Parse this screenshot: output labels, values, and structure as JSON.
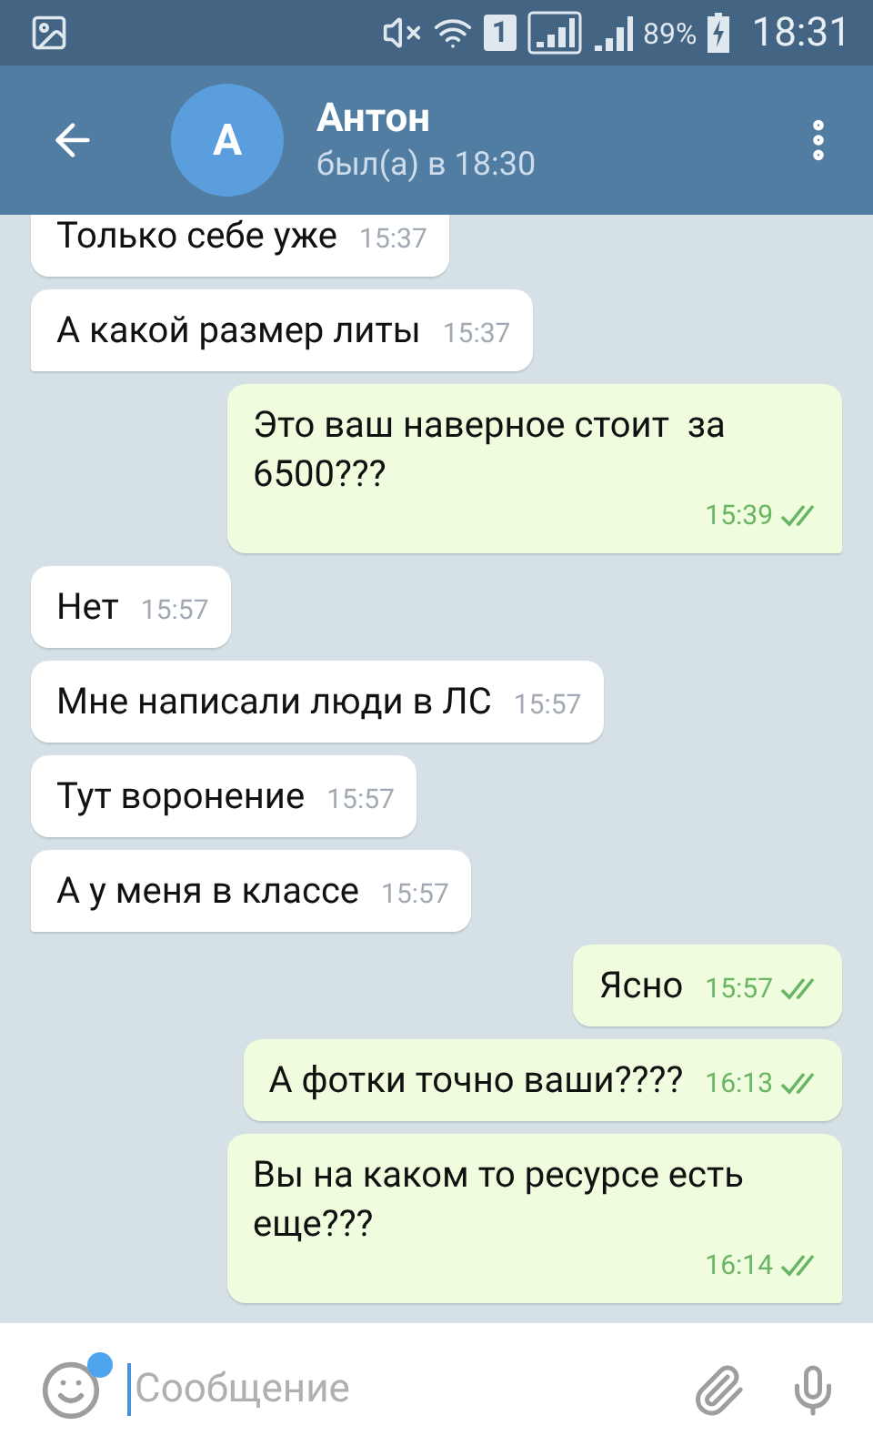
{
  "status_bar": {
    "sim_label": "1",
    "battery": "89%",
    "time": "18:31"
  },
  "header": {
    "avatar_letter": "А",
    "name": "Антон",
    "status": "был(а) в 18:30"
  },
  "messages": [
    {
      "kind": "in",
      "text": "Только себе уже",
      "time": "15:37",
      "tail": false
    },
    {
      "kind": "in",
      "text": "А какой размер литы",
      "time": "15:37",
      "tail": true
    },
    {
      "kind": "out",
      "text": "Это ваш наверное стоит  за 6500???",
      "time": "15:39",
      "tail": true,
      "read": true
    },
    {
      "kind": "in",
      "text": "Нет",
      "time": "15:57",
      "tail": false
    },
    {
      "kind": "in",
      "text": "Мне написали люди в ЛС",
      "time": "15:57",
      "tail": false
    },
    {
      "kind": "in",
      "text": "Тут воронение",
      "time": "15:57",
      "tail": false
    },
    {
      "kind": "in",
      "text": "А у меня в классе",
      "time": "15:57",
      "tail": true
    },
    {
      "kind": "out",
      "text": "Ясно",
      "time": "15:57",
      "tail": false,
      "read": true
    },
    {
      "kind": "out",
      "text": "А фотки точно ваши????",
      "time": "16:13",
      "tail": false,
      "read": true
    },
    {
      "kind": "out",
      "text": "Вы на каком то ресурсе есть еще???",
      "time": "16:14",
      "tail": true,
      "read": true
    }
  ],
  "composer": {
    "placeholder": "Сообщение",
    "emoji_dot": true
  }
}
